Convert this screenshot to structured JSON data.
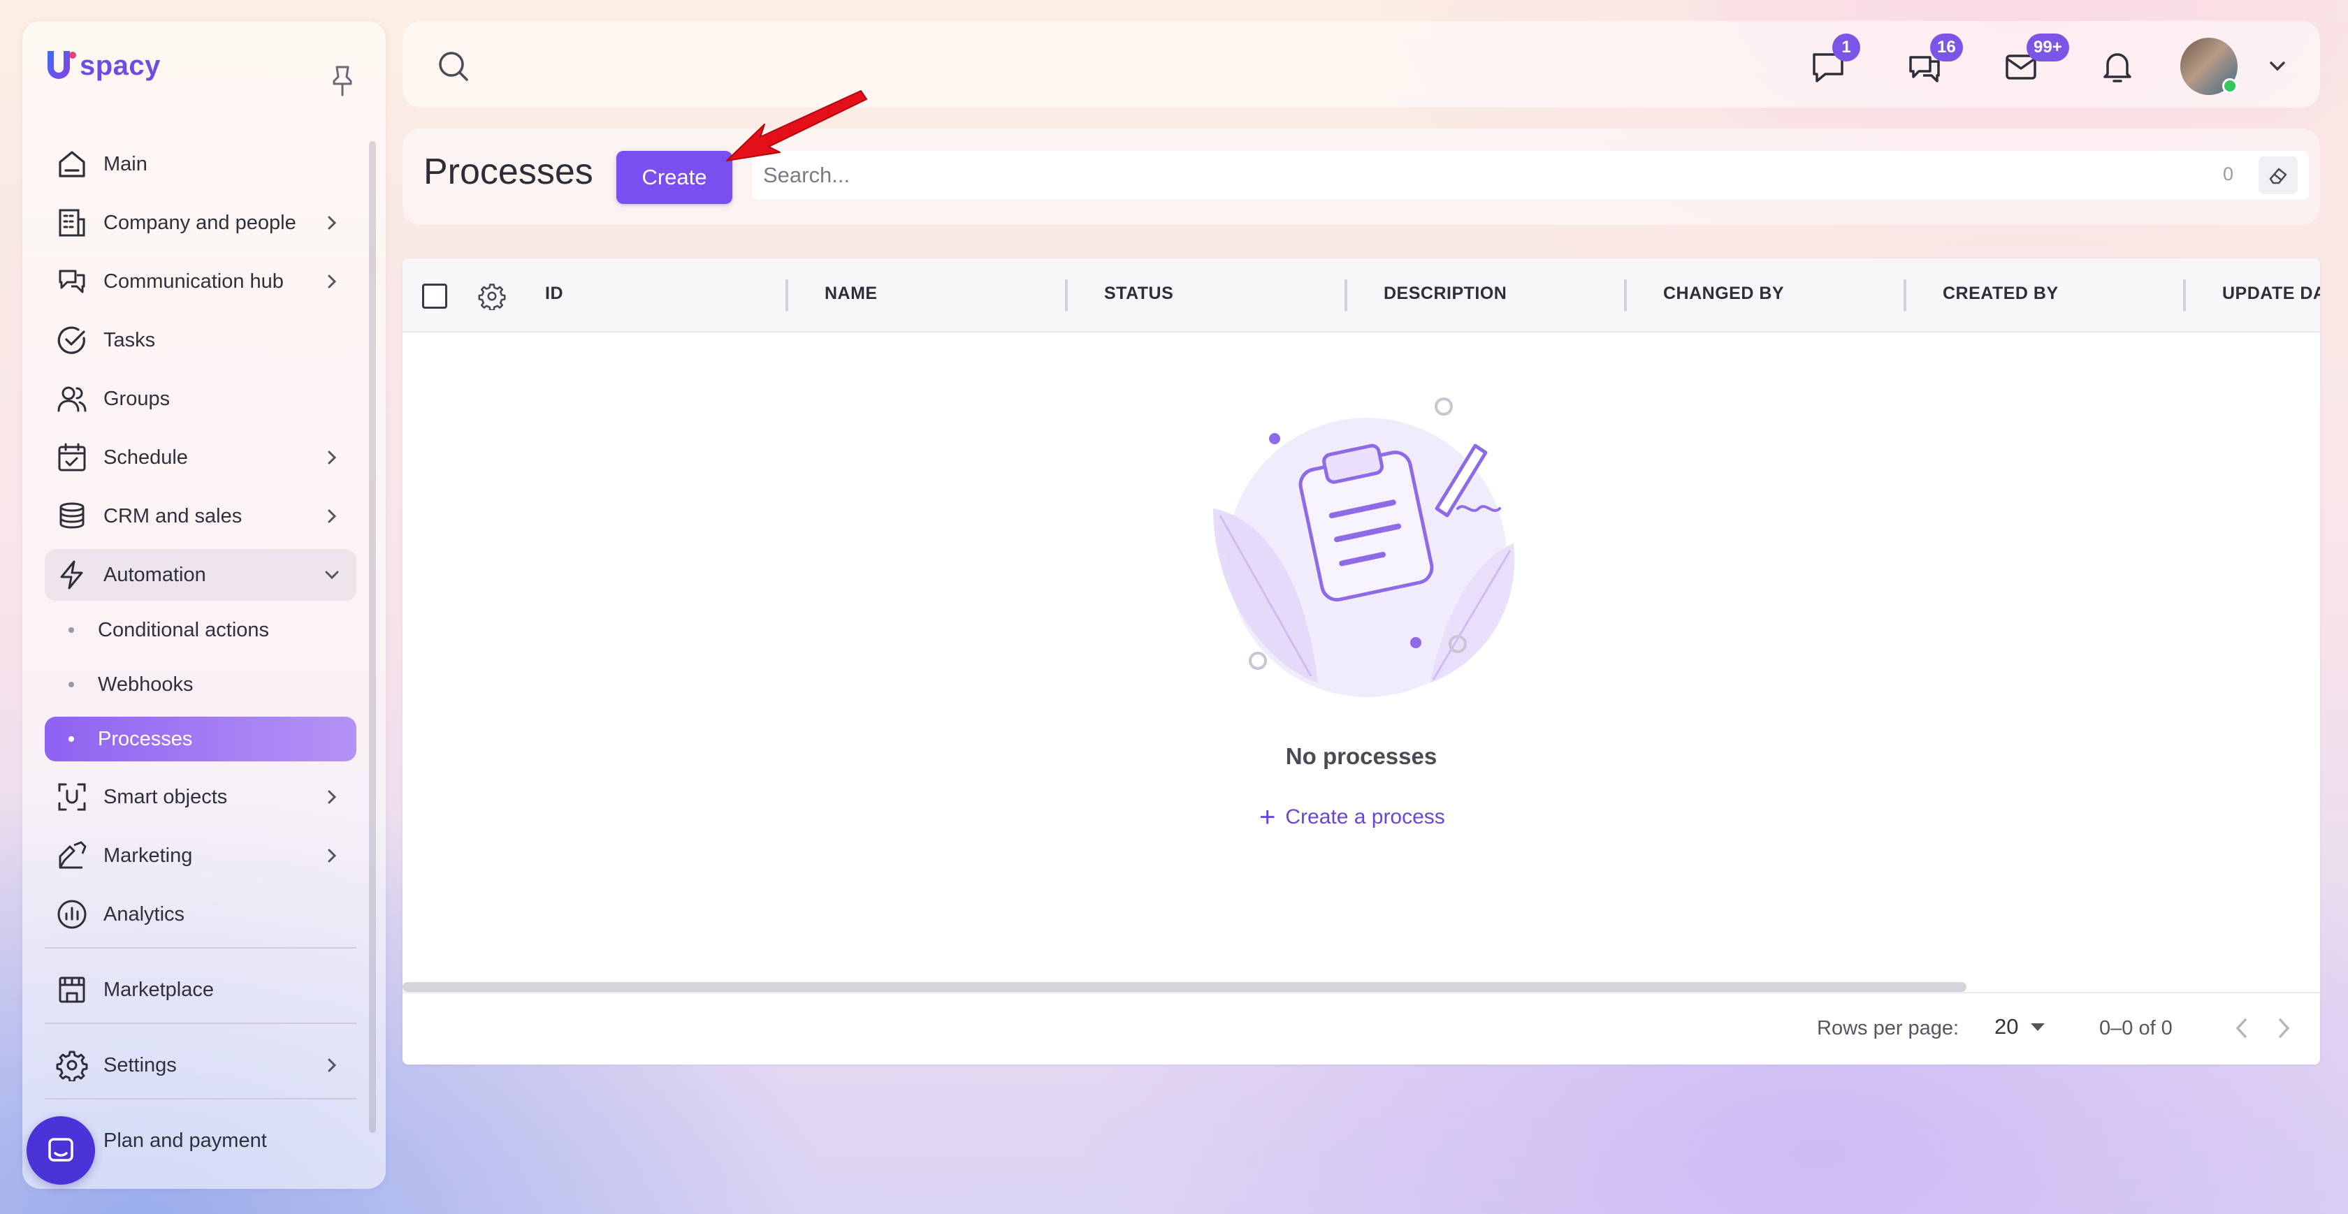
{
  "app": {
    "logo_letter": "U",
    "logo_text": "spacy",
    "brand_color": "#7a4ff0"
  },
  "sidebar": {
    "items": [
      {
        "label": "Main",
        "icon": "home-icon",
        "expandable": false
      },
      {
        "label": "Company and people",
        "icon": "building-icon",
        "expandable": true
      },
      {
        "label": "Communication hub",
        "icon": "communication-icon",
        "expandable": true
      },
      {
        "label": "Tasks",
        "icon": "check-circle-icon",
        "expandable": false
      },
      {
        "label": "Groups",
        "icon": "users-icon",
        "expandable": false
      },
      {
        "label": "Schedule",
        "icon": "calendar-icon",
        "expandable": true
      },
      {
        "label": "CRM and sales",
        "icon": "database-icon",
        "expandable": true
      },
      {
        "label": "Automation",
        "icon": "lightning-icon",
        "expandable": true,
        "open": true
      }
    ],
    "automation_sub": [
      {
        "label": "Conditional actions",
        "active": false
      },
      {
        "label": "Webhooks",
        "active": false
      },
      {
        "label": "Processes",
        "active": true
      }
    ],
    "items_after": [
      {
        "label": "Smart objects",
        "icon": "scan-icon",
        "expandable": true
      },
      {
        "label": "Marketing",
        "icon": "marketing-icon",
        "expandable": true
      },
      {
        "label": "Analytics",
        "icon": "analytics-icon",
        "expandable": false
      }
    ],
    "marketplace": {
      "label": "Marketplace",
      "icon": "store-icon"
    },
    "settings": {
      "label": "Settings",
      "icon": "gear-icon"
    },
    "plan": {
      "label": "Plan and payment",
      "icon": "card-icon"
    }
  },
  "header": {
    "badges": {
      "chat": "1",
      "messages": "16",
      "mail": "99+"
    }
  },
  "page": {
    "title": "Processes",
    "create_label": "Create",
    "search_placeholder": "Search...",
    "search_count": "0"
  },
  "table": {
    "columns": [
      "ID",
      "NAME",
      "STATUS",
      "DESCRIPTION",
      "CHANGED BY",
      "CREATED BY",
      "UPDATE DAT"
    ],
    "empty_title": "No processes",
    "create_link": "Create a process",
    "rows_per_page_label": "Rows per page:",
    "rows_per_page_value": "20",
    "range_label": "0–0 of 0"
  }
}
